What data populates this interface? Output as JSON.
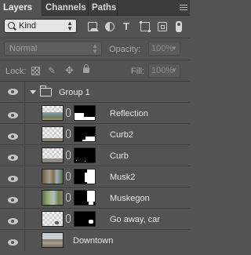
{
  "tabs": [
    {
      "label": "Layers",
      "active": true
    },
    {
      "label": "Channels",
      "active": false
    },
    {
      "label": "Paths",
      "active": false
    }
  ],
  "filter": {
    "kind_label": "Kind",
    "icons": [
      "image-filter-icon",
      "adjustment-filter-icon",
      "type-filter-icon",
      "shape-filter-icon",
      "smart-object-filter-icon",
      "filter-toggle-icon"
    ]
  },
  "blend": {
    "mode": "Normal",
    "opacity_label": "Opacity:",
    "opacity_value": "100%"
  },
  "lock": {
    "label": "Lock:",
    "fill_label": "Fill:",
    "fill_value": "100%"
  },
  "group": {
    "name": "Group 1",
    "expanded": true
  },
  "layers": [
    {
      "name": "Reflection",
      "has_mask": true
    },
    {
      "name": "Curb2",
      "has_mask": true
    },
    {
      "name": "Curb",
      "has_mask": true
    },
    {
      "name": "Musk2",
      "has_mask": true
    },
    {
      "name": "Muskegon",
      "has_mask": true
    },
    {
      "name": "Go away, car",
      "has_mask": true
    },
    {
      "name": "Downtown",
      "has_mask": false
    }
  ],
  "colors": {
    "panel_bg": "#535353",
    "tab_bar": "#3c3c3c",
    "text": "#e8e8e8"
  }
}
